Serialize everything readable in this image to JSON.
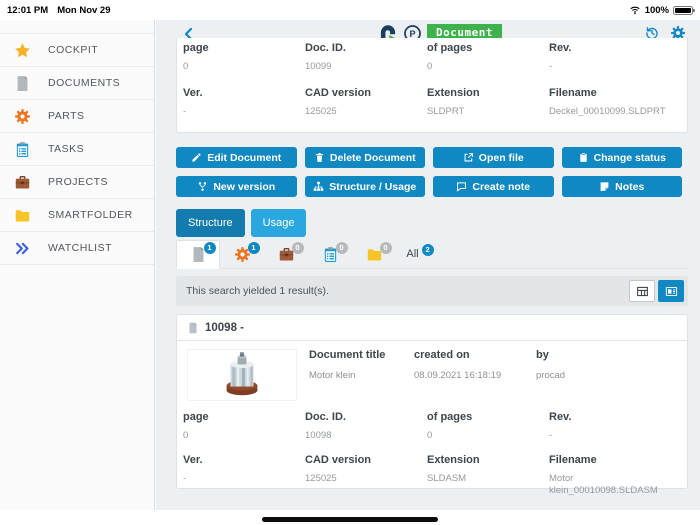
{
  "status_bar": {
    "time": "12:01 PM",
    "date": "Mon Nov 29",
    "battery": "100%"
  },
  "header": {
    "app_badge": "Document"
  },
  "colors": {
    "accent_blue": "#1088c2",
    "tab_active_blue": "#137bad",
    "tab_inactive_blue": "#2ba7e0",
    "badge_green": "#3eb24b",
    "badge_gray": "#b6babd"
  },
  "sidebar": {
    "items": [
      {
        "label": "COCKPIT",
        "icon": "star-icon"
      },
      {
        "label": "DOCUMENTS",
        "icon": "document-icon"
      },
      {
        "label": "PARTS",
        "icon": "gear-icon"
      },
      {
        "label": "TASKS",
        "icon": "tasks-icon"
      },
      {
        "label": "PROJECTS",
        "icon": "briefcase-icon"
      },
      {
        "label": "SMARTFOLDER",
        "icon": "folder-icon"
      },
      {
        "label": "WATCHLIST",
        "icon": "double-chevron-icon"
      }
    ]
  },
  "doc_summary": {
    "fields": [
      {
        "label": "page",
        "value": "0"
      },
      {
        "label": "Doc. ID.",
        "value": "10099"
      },
      {
        "label": "of pages",
        "value": "0"
      },
      {
        "label": "Rev.",
        "value": "-"
      },
      {
        "label": "Ver.",
        "value": "-"
      },
      {
        "label": "CAD version",
        "value": "125025"
      },
      {
        "label": "Extension",
        "value": "SLDPRT"
      },
      {
        "label": "Filename",
        "value": "Deckel_00010099.SLDPRT"
      }
    ]
  },
  "actions": {
    "buttons": [
      {
        "label": "Edit Document",
        "icon": "pencil-icon"
      },
      {
        "label": "Delete Document",
        "icon": "trash-icon"
      },
      {
        "label": "Open file",
        "icon": "open-external-icon"
      },
      {
        "label": "Change status",
        "icon": "clipboard-icon"
      },
      {
        "label": "New version",
        "icon": "branch-icon"
      },
      {
        "label": "Structure / Usage",
        "icon": "sitemap-icon"
      },
      {
        "label": "Create note",
        "icon": "comment-icon"
      },
      {
        "label": "Notes",
        "icon": "note-icon"
      }
    ]
  },
  "tabs": [
    {
      "label": "Structure",
      "active": true
    },
    {
      "label": "Usage",
      "active": false
    }
  ],
  "filters": {
    "items": [
      {
        "name": "documents",
        "count": "1",
        "badge": "blue",
        "active": true
      },
      {
        "name": "parts",
        "count": "1",
        "badge": "blue",
        "active": false
      },
      {
        "name": "projects",
        "count": "0",
        "badge": "gray",
        "active": false
      },
      {
        "name": "tasks",
        "count": "0",
        "badge": "gray",
        "active": false
      },
      {
        "name": "smartfolder",
        "count": "0",
        "badge": "gray",
        "active": false
      },
      {
        "name": "all",
        "label": "All",
        "count": "2",
        "badge": "blue",
        "active": false
      }
    ]
  },
  "results": {
    "message": "This search yielded 1 result(s)."
  },
  "result_card": {
    "title": "10098 -",
    "meta": [
      {
        "label": "Document title",
        "value": "Motor klein"
      },
      {
        "label": "created on",
        "value": "08.09.2021 16:18:19"
      },
      {
        "label": "by",
        "value": "procad"
      }
    ],
    "fields": [
      {
        "label": "page",
        "value": "0"
      },
      {
        "label": "Doc. ID.",
        "value": "10098"
      },
      {
        "label": "of pages",
        "value": "0"
      },
      {
        "label": "Rev.",
        "value": "-"
      },
      {
        "label": "Ver.",
        "value": "-"
      },
      {
        "label": "CAD version",
        "value": "125025"
      },
      {
        "label": "Extension",
        "value": "SLDASM"
      },
      {
        "label": "Filename",
        "value": "Motor klein_00010098.SLDASM"
      }
    ]
  }
}
